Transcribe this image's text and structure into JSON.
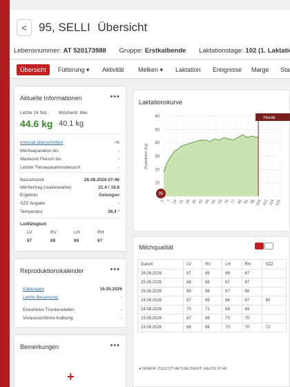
{
  "header": {
    "back_label": "<",
    "animal": "95, SELLI",
    "view_title": "Übersicht",
    "lebensnummer_label": "Lebensnummer:",
    "lebensnummer_value": "AT 520173988",
    "gruppe_label": "Gruppe:",
    "gruppe_value": "Erstkalbende",
    "laktation_label": "Laktationstage:",
    "laktation_value": "102 (1. Laktatio"
  },
  "tabs": [
    {
      "label": "Übersicht"
    },
    {
      "label": "Fütterung ▾"
    },
    {
      "label": "Aktivität"
    },
    {
      "label": "Melken ▾"
    },
    {
      "label": "Laktation"
    },
    {
      "label": "Ereignisse"
    },
    {
      "label": "Marge"
    },
    {
      "label": "Sta"
    }
  ],
  "aktuelle": {
    "title": "Aktuelle Informationen",
    "menu": "•••",
    "last24_label": "Letzte 24 Std.",
    "weekly_label": "Wöchentl. Mw.",
    "last24_value": "44.6 kg",
    "weekly_value": "40.1 kg",
    "intervall_label": "Intervall überschritten",
    "intervall_value": "-%",
    "milchsep_label": "Milchseparation bis",
    "milchsep_value": "-",
    "wartezeit_label": "Wartezeit Fleisch bis",
    "wartezeit_value": "-",
    "tiersep_label": "Letzter Tierseparationsbesuch",
    "tiersep_value": "-",
    "besuch_label": "Besuchszeit",
    "besuch_value": "26.08.2026 07:46",
    "ertrag_label": "Milchertrag (real/erwartet)",
    "ertrag_value": "21.4 / 18.8",
    "ergebnis_label": "Ergebnis",
    "ergebnis_value": "Gelungen",
    "szz_label": "SZZ Angabe",
    "szz_value": "-",
    "temp_label": "Temperatur",
    "temp_value": "38,4 °",
    "leit_title": "Leitfähigkeit",
    "leit_headers": [
      "LV",
      "RV",
      "LH",
      "RH"
    ],
    "leit_values": [
      "67",
      "69",
      "68",
      "67"
    ]
  },
  "repro": {
    "title": "Reproduktionskalender",
    "menu": "•••",
    "kalbungen_label": "Kalbungen",
    "kalbungen_value": "16.05.2026",
    "besamung_label": "Letzte Besamung",
    "besamung_value": "-",
    "trocken_label": "Erwartetes Trockenstellen",
    "trocken_value": "-",
    "vorauss_label": "Voraussichtliche Kalbung",
    "vorauss_value": "-"
  },
  "bemerkungen": {
    "title": "Bemerkungen",
    "menu": "•••",
    "add": "+"
  },
  "laktationskurve": {
    "title": "Laktationskurve",
    "menu": "•••",
    "heute": "Heute",
    "ylabel": "Produktion (kg)",
    "marker": "95"
  },
  "chart_data": {
    "type": "area",
    "title": "Laktationskurve",
    "xlabel": "",
    "ylabel": "Produktion (kg)",
    "ylim": [
      0,
      60
    ],
    "yticks": [
      0,
      10,
      20,
      30,
      40,
      50,
      60
    ],
    "xlim": [
      0,
      125
    ],
    "xticks": [
      0,
      7,
      14,
      21,
      28,
      35,
      42,
      49,
      56,
      63,
      70,
      77,
      84,
      91,
      98,
      105,
      112,
      119,
      126
    ],
    "today_x": 102,
    "series": [
      {
        "name": "",
        "x": [
          0,
          3,
          6,
          9,
          12,
          15,
          18,
          21,
          25,
          30,
          35,
          40,
          45,
          50,
          55,
          60,
          65,
          70,
          75,
          80,
          85,
          90,
          95,
          100,
          102
        ],
        "y": [
          18,
          24,
          28,
          31,
          34,
          35,
          37,
          38,
          39,
          40,
          41,
          42,
          42,
          41,
          43,
          42,
          44,
          43,
          42,
          44,
          46,
          44,
          45,
          44,
          44.6
        ]
      }
    ],
    "colors": {
      "fill": "#c9e3b3",
      "line": "#5f9c3b",
      "heute": "#7a1f1f"
    }
  },
  "milchqualitaet": {
    "title": "Milchqualität",
    "columns": [
      "Datum",
      "LV",
      "RV",
      "LH",
      "RH",
      "SZZ"
    ],
    "rows": [
      [
        "26.08.2026",
        "67",
        "69",
        "68",
        "67",
        ""
      ],
      [
        "25.08.2026",
        "68",
        "66",
        "67",
        "67",
        ""
      ],
      [
        "25.08.2026",
        "68",
        "68",
        "67",
        "68",
        ""
      ],
      [
        "24.08.2026",
        "67",
        "69",
        "66",
        "67",
        "80"
      ],
      [
        "24.08.2026",
        "70",
        "71",
        "69",
        "69",
        ""
      ],
      [
        "23.08.2026",
        "67",
        "68",
        "70",
        "70",
        ""
      ],
      [
        "23.08.2026",
        "68",
        "68",
        "70",
        "70",
        "72"
      ]
    ],
    "footer": "GRAFIK ZULETZT AKTUALISIERT: HEUTE 07:46"
  }
}
